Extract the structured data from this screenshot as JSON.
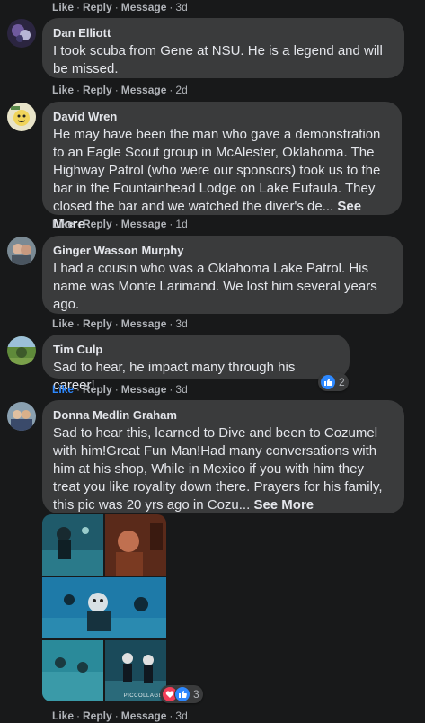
{
  "action_labels": {
    "like": "Like",
    "reply": "Reply",
    "message": "Message",
    "sep": "·"
  },
  "comments": [
    {
      "time": "3d"
    },
    {
      "author": "Dan Elliott",
      "text": "I took scuba from Gene at NSU. He is a legend and will be missed.",
      "time": "2d"
    },
    {
      "author": "David Wren",
      "text": "He may have been the man who gave a demonstration to an Eagle Scout group in McAlester, Oklahoma. The Highway Patrol (who were our sponsors) took us to the bar in the Fountainhead Lodge on Lake Eufaula. They closed the bar and we watched the diver's de...",
      "see_more": "See More",
      "time": "1d"
    },
    {
      "author": "Ginger Wasson Murphy",
      "text": "I had a cousin who was a Oklahoma Lake Patrol. His name was Monte Larimand. We lost him several years ago.",
      "time": "3d"
    },
    {
      "author": "Tim Culp",
      "text": "Sad to hear, he impact many through his career!",
      "time": "3d",
      "reaction_count": "2"
    },
    {
      "author": "Donna Medlin Graham",
      "text": "Sad to hear this, learned to Dive and been to Cozumel with him!Great Fun Man!Had many conversations with him at his shop, While in Mexico if you with him they treat you like royality down there. Prayers for his family, this pic was 20 yrs ago in Cozu...",
      "see_more": "See More",
      "time": "3d",
      "reaction_count": "3",
      "photo_watermark": "PICCOLLAGE"
    }
  ],
  "icons": {
    "like": "thumbs-up-icon",
    "love": "heart-icon"
  },
  "colors": {
    "background": "#18191a",
    "bubble": "#3a3b3c",
    "link_blue": "#2d88ff",
    "muted": "#b0b3b8"
  }
}
